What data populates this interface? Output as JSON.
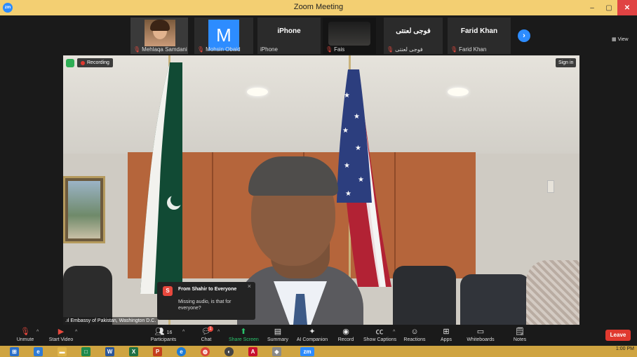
{
  "window": {
    "title": "Zoom Meeting",
    "app_logo": "zm",
    "controls": [
      "–",
      "▢",
      "✕"
    ]
  },
  "participants_strip": {
    "tiles": [
      {
        "name": "Mehlaqa Samdani",
        "muted": true,
        "type": "video",
        "hand_raised": true
      },
      {
        "name": "Mohsin Obaid",
        "muted": true,
        "type": "avatar",
        "avatar_letter": "M"
      },
      {
        "name": "iPhone",
        "muted": false,
        "type": "name",
        "display": "iPhone"
      },
      {
        "name": "Fais",
        "muted": true,
        "type": "video"
      },
      {
        "name": "فوجی لعنتی",
        "muted": true,
        "type": "name",
        "display": "فوجی لعنتی"
      },
      {
        "name": "Farid Khan",
        "muted": true,
        "type": "name",
        "display": "Farid Khan"
      }
    ],
    "next_icon": "chevron-right-icon",
    "view_label": "View"
  },
  "video": {
    "recording_label": "Recording",
    "sign_in_label": "Sign in",
    "speaker_label": "Embassy of Pakistan, Washington D.C."
  },
  "chat_toast": {
    "avatar_letter": "S",
    "from": "From Shahir to Everyone",
    "message": "Missing audio, is that for everyone?"
  },
  "toolbar": {
    "unmute": "Unmute",
    "start_video": "Start Video",
    "participants": "Participants",
    "participants_count": "16",
    "chat": "Chat",
    "chat_badge": "1",
    "share_screen": "Share Screen",
    "summary": "Summary",
    "ai_companion": "AI Companion",
    "record": "Record",
    "show_captions": "Show Captions",
    "reactions": "Reactions",
    "apps": "Apps",
    "whiteboards": "Whiteboards",
    "notes": "Notes",
    "leave": "Leave"
  },
  "colors": {
    "accent": "#2d8cff",
    "leave": "#e0392f",
    "share": "#29c16b",
    "title_bar": "#f3cf72",
    "taskbar": "#cfa441"
  },
  "taskbar": {
    "time": "1:00 PM"
  }
}
